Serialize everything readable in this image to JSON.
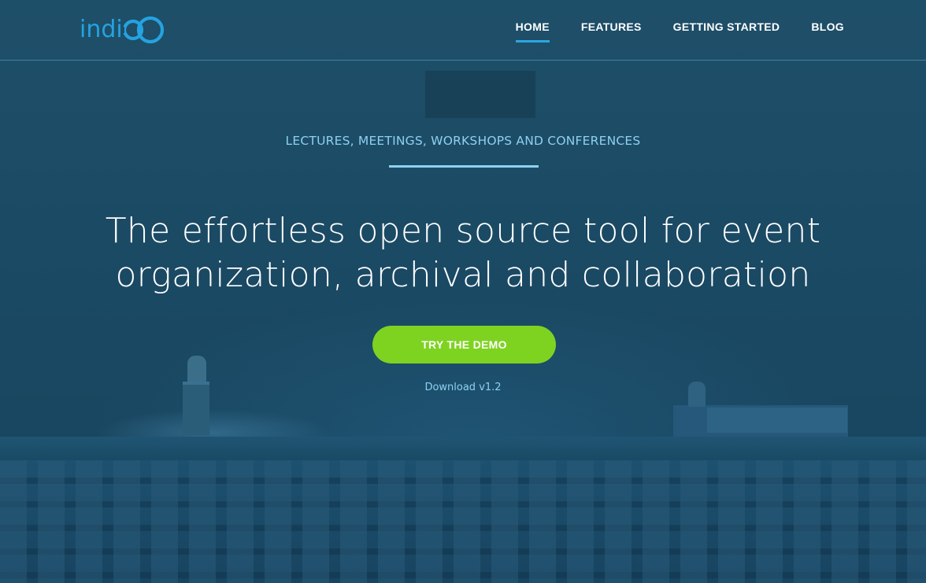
{
  "brand": {
    "logo_text": "indi",
    "logo_icon": "infinity-co-logo-mark",
    "color": "#24a3e0"
  },
  "nav": {
    "items": [
      {
        "label": "HOME",
        "active": true
      },
      {
        "label": "FEATURES",
        "active": false
      },
      {
        "label": "GETTING STARTED",
        "active": false
      },
      {
        "label": "BLOG",
        "active": false
      }
    ],
    "active_underline_color": "#2ba6e2"
  },
  "hero": {
    "kicker": "LECTURES, MEETINGS, WORKSHOPS AND CONFERENCES",
    "headline_line1": "The effortless open source tool for event",
    "headline_line2": "organization, archival and collaboration",
    "cta_label": "TRY THE DEMO",
    "cta_color": "#7ed321",
    "download_label": "Download v1.2",
    "accent_color": "#8fd0f0",
    "background_color": "#1b4a63"
  }
}
